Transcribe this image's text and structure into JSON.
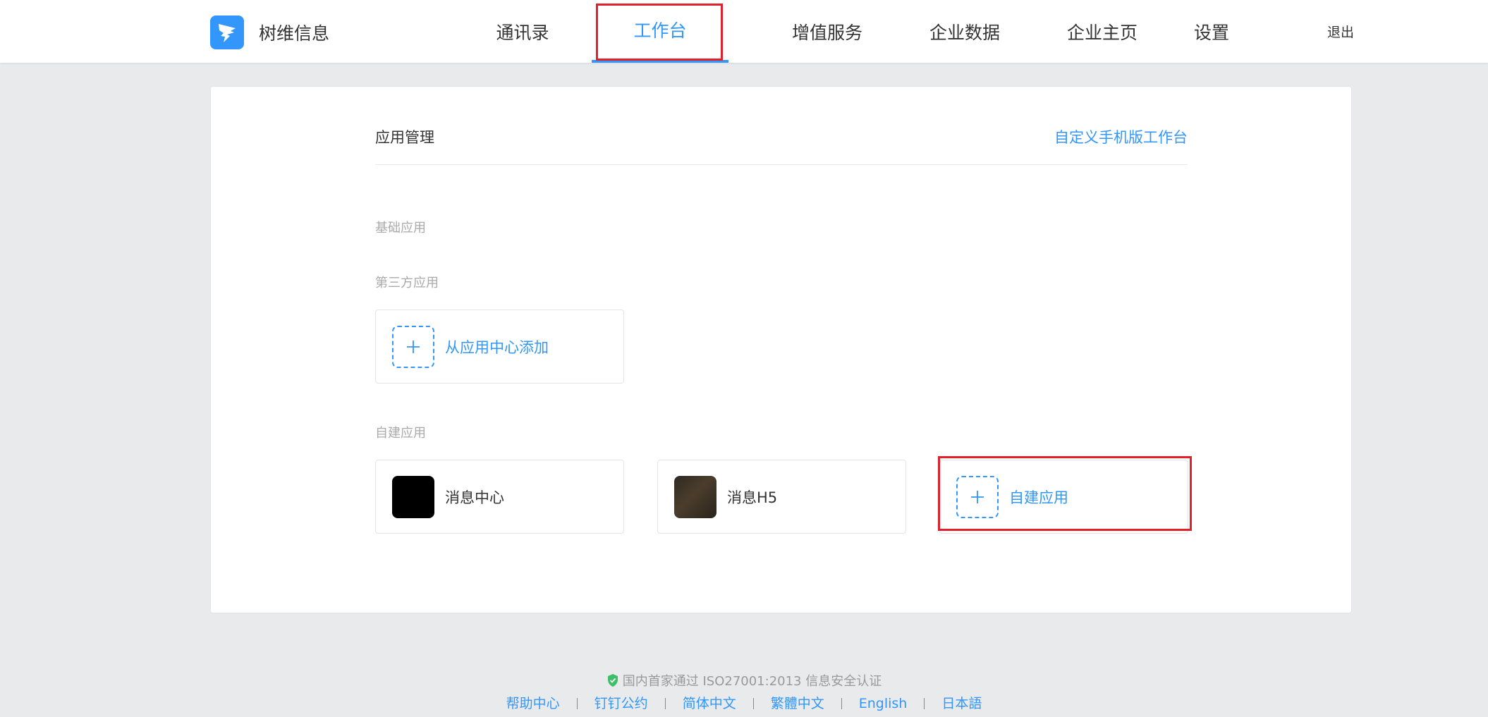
{
  "brand": {
    "name": "树维信息",
    "logo_icon": "dingtalk-logo-icon",
    "logo_color": "#3296fa"
  },
  "nav": {
    "items": [
      {
        "label": "通讯录"
      },
      {
        "label": "工作台",
        "active": true
      },
      {
        "label": "增值服务"
      },
      {
        "label": "企业数据"
      },
      {
        "label": "企业主页"
      },
      {
        "label": "设置"
      }
    ],
    "logout_label": "退出"
  },
  "main": {
    "title": "应用管理",
    "custom_link": "自定义手机版工作台",
    "groups": {
      "basic": {
        "label": "基础应用"
      },
      "third_party": {
        "label": "第三方应用",
        "add_label": "从应用中心添加"
      },
      "custom": {
        "label": "自建应用",
        "apps": [
          {
            "name": "消息中心"
          },
          {
            "name": "消息H5"
          }
        ],
        "add_label": "自建应用"
      }
    }
  },
  "footer": {
    "certification": "国内首家通过 ISO27001:2013 信息安全认证",
    "links": [
      "帮助中心",
      "钉钉公约",
      "简体中文",
      "繁體中文",
      "English",
      "日本語"
    ]
  },
  "colors": {
    "accent": "#3296fa",
    "highlight": "#e0202a",
    "background": "#e9eaec",
    "cert_shield": "#3dbf6a"
  }
}
